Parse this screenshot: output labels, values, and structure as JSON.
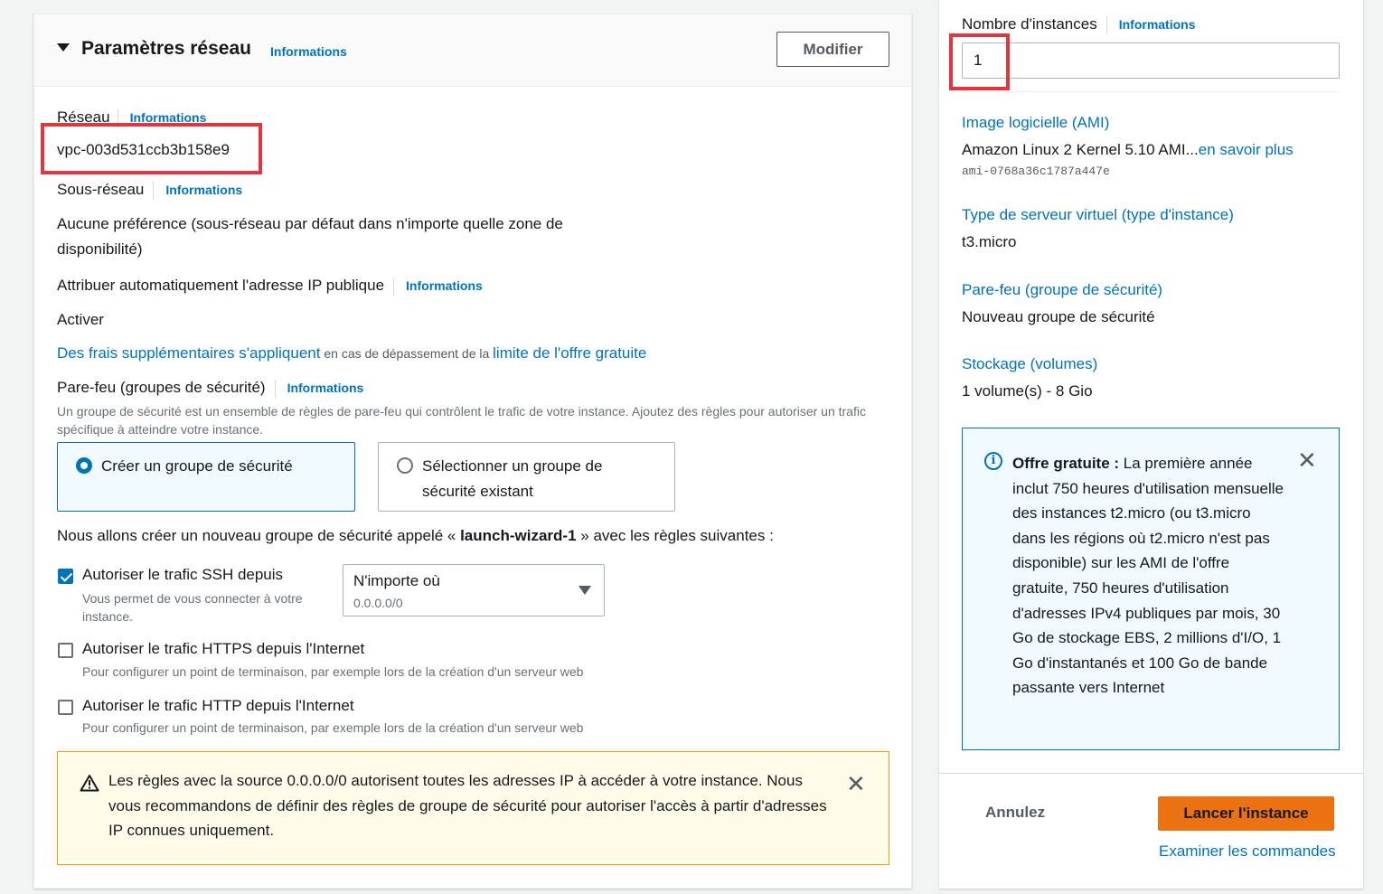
{
  "network": {
    "title": "Paramètres réseau",
    "info": "Informations",
    "modify": "Modifier",
    "network_label": "Réseau",
    "network_value": "vpc-003d531ccb3b158e9",
    "subnet_label": "Sous-réseau",
    "subnet_value": "Aucune préférence (sous-réseau par défaut dans n'importe quelle zone de disponibilité)",
    "auto_ip_label": "Attribuer automatiquement l'adresse IP publique",
    "auto_ip_value": "Activer",
    "fees_link": "Des frais supplémentaires s'appliquent",
    "fees_mid": " en cas de dépassement de la ",
    "fees_link2": "limite de l'offre gratuite",
    "firewall_label": "Pare-feu (groupes de sécurité)",
    "firewall_desc": "Un groupe de sécurité est un ensemble de règles de pare-feu qui contrôlent le trafic de votre instance. Ajoutez des règles pour autoriser un trafic spécifique à atteindre votre instance.",
    "radio_create": "Créer un groupe de sécurité",
    "radio_select": "Sélectionner un groupe de sécurité existant",
    "new_group_pre": "Nous allons créer un nouveau groupe de sécurité appelé « ",
    "new_group_name": "launch-wizard-1",
    "new_group_post": " » avec les règles suivantes :",
    "ssh_label": "Autoriser le trafic SSH depuis",
    "ssh_desc": "Vous permet de vous connecter à votre instance.",
    "ssh_select_value": "N'importe où",
    "ssh_select_sub": "0.0.0.0/0",
    "https_label": "Autoriser le trafic HTTPS depuis l'Internet",
    "https_desc": "Pour configurer un point de terminaison, par exemple lors de la création d'un serveur web",
    "http_label": "Autoriser le trafic HTTP depuis l'Internet",
    "http_desc": "Pour configurer un point de terminaison, par exemple lors de la création d'un serveur web",
    "warning_text": "Les règles avec la source 0.0.0.0/0 autorisent toutes les adresses IP à accéder à votre instance. Nous vous recommandons de définir des règles de groupe de sécurité pour autoriser l'accès à partir d'adresses IP connues uniquement."
  },
  "summary": {
    "instances_label": "Nombre d'instances",
    "info": "Informations",
    "instances_value": "1",
    "ami_title": "Image logicielle (AMI)",
    "ami_value": "Amazon Linux 2 Kernel 5.10 AMI...",
    "ami_more": "en savoir plus",
    "ami_id": "ami-0768a36c1787a447e",
    "type_title": "Type de serveur virtuel (type d'instance)",
    "type_value": "t3.micro",
    "firewall_title": "Pare-feu (groupe de sécurité)",
    "firewall_value": "Nouveau groupe de sécurité",
    "storage_title": "Stockage (volumes)",
    "storage_value": "1 volume(s) - 8 Gio",
    "free_tier_bold": "Offre gratuite :",
    "free_tier_text": " La première année inclut 750 heures d'utilisation mensuelle des instances t2.micro (ou t3.micro dans les régions où t2.micro n'est pas disponible) sur les AMI de l'offre gratuite, 750 heures d'utilisation d'adresses IPv4 publiques par mois, 30 Go de stockage EBS, 2 millions d'I/O, 1 Go d'instantanés et 100 Go de bande passante vers Internet",
    "cancel": "Annulez",
    "launch": "Lancer l'instance",
    "review": "Examiner les commandes"
  },
  "colors": {
    "accent": "#0073bb",
    "launch": "#ec7211",
    "highlight": "#e3353d",
    "warning_bg": "#fffce9"
  }
}
